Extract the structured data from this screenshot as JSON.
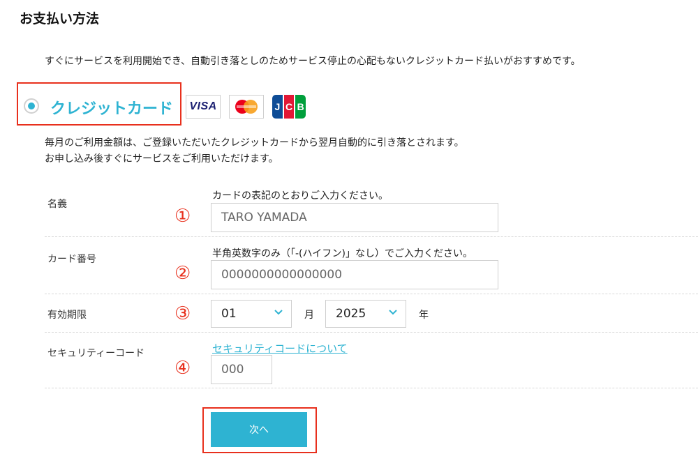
{
  "page": {
    "title": "お支払い方法",
    "intro": "すぐにサービスを利用開始でき、自動引き落としのためサービス停止の心配もないクレジットカード払いがおすすめです。"
  },
  "payment_option": {
    "label": "クレジットカード",
    "selected": true,
    "brands": [
      "VISA",
      "Mastercard",
      "JCB"
    ],
    "visa_text": "VISA",
    "jcb_text": "JCB",
    "note_line1": "毎月のご利用金額は、ご登録いただいたクレジットカードから翌月自動的に引き落とされます。",
    "note_line2": "お申し込み後すぐにサービスをご利用いただけます。"
  },
  "form": {
    "name": {
      "label": "名義",
      "marker": "①",
      "hint": "カードの表記のとおりご入力ください。",
      "placeholder": "TARO YAMADA"
    },
    "card_number": {
      "label": "カード番号",
      "marker": "②",
      "hint": "半角英数字のみ（「-(ハイフン)」なし）でご入力ください。",
      "placeholder": "0000000000000000"
    },
    "expiry": {
      "label": "有効期限",
      "marker": "③",
      "month_value": "01",
      "month_unit": "月",
      "year_value": "2025",
      "year_unit": "年"
    },
    "security_code": {
      "label": "セキュリティーコード",
      "marker": "④",
      "link_text": "セキュリティコードについて",
      "placeholder": "000"
    }
  },
  "actions": {
    "next_label": "次へ"
  },
  "colors": {
    "accent": "#2eb3d2",
    "highlight": "#e8301d",
    "visa_blue": "#1a1f71",
    "mc_red": "#eb001b",
    "mc_orange": "#f79e1b",
    "jcb_blue": "#0e4c96",
    "jcb_red": "#e21836",
    "jcb_green": "#009f3c"
  }
}
